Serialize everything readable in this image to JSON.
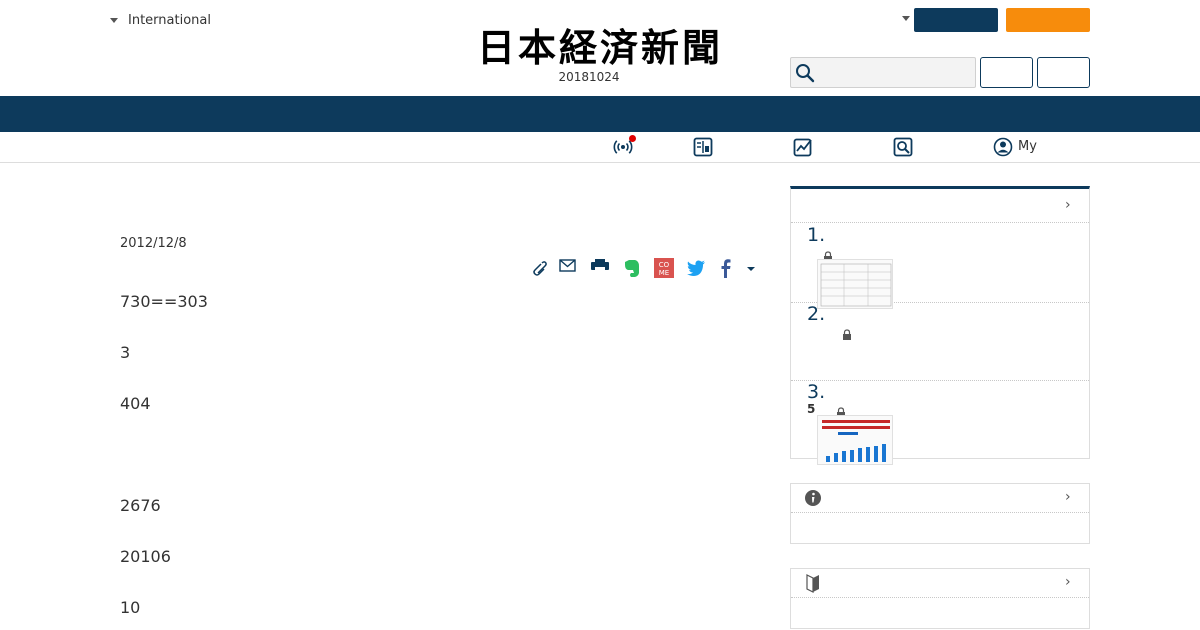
{
  "header": {
    "edition_label": "International",
    "logo_text": "日本経済新聞",
    "date": "20181024",
    "search_placeholder": "",
    "my_label": "My"
  },
  "article": {
    "date": "2012/12/8",
    "paragraphs": [
      "730==303",
      "3",
      "404",
      "2676",
      "20106",
      "10"
    ]
  },
  "ranking": {
    "items": [
      {
        "num": "1."
      },
      {
        "num": "2."
      },
      {
        "num": "3.",
        "sub": "5"
      }
    ]
  },
  "icons": {
    "subnav": [
      "live-broadcast-icon",
      "newspaper-icon",
      "market-chart-icon",
      "search-doc-icon",
      "user-icon"
    ],
    "share": [
      "clip-icon",
      "mail-icon",
      "print-icon",
      "evernote-icon",
      "comemo-icon",
      "twitter-icon",
      "facebook-icon",
      "more-icon"
    ]
  },
  "colors": {
    "navy": "#0d3a5c",
    "orange": "#f78c0c",
    "twitter": "#1da1f2",
    "facebook": "#3b5998",
    "evernote": "#2dbe60",
    "comemo": "#d9534f",
    "live": "#e00000"
  }
}
